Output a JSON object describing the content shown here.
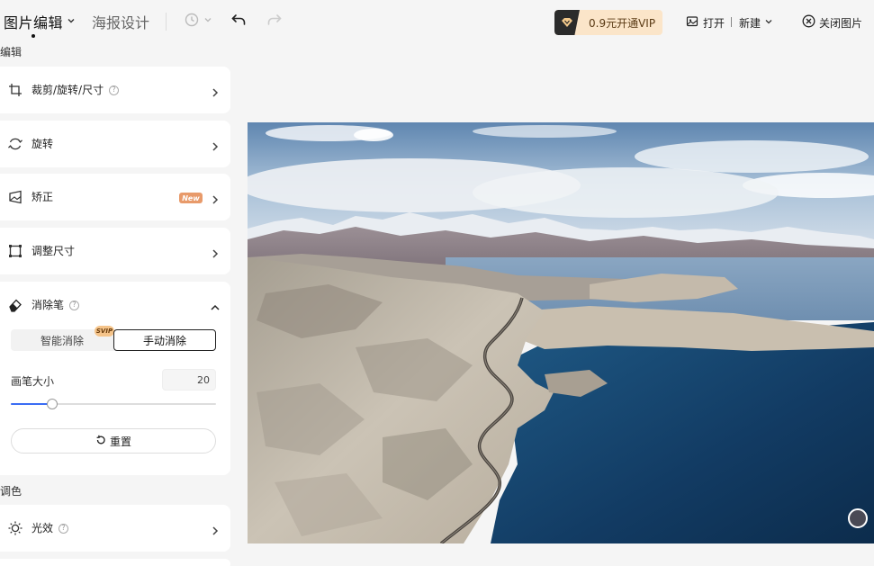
{
  "header": {
    "active_tab": "图片编辑",
    "inactive_tab": "海报设计",
    "vip_label": "0.9元开通VIP",
    "open_label": "打开",
    "new_label": "新建",
    "close_label": "关闭图片"
  },
  "sections": {
    "edit": "编辑",
    "color": "调色"
  },
  "tools": {
    "crop": "裁剪/旋转/尺寸",
    "rotate": "旋转",
    "correct": "矫正",
    "correct_badge": "New",
    "resize": "调整尺寸",
    "eraser": "消除笔",
    "light": "光效"
  },
  "eraser": {
    "smart_label": "智能消除",
    "smart_badge": "SVIP",
    "manual_label": "手动消除",
    "brush_size_label": "画笔大小",
    "brush_size_value": "20",
    "brush_size_fraction": 0.2,
    "reset_label": "重置"
  }
}
